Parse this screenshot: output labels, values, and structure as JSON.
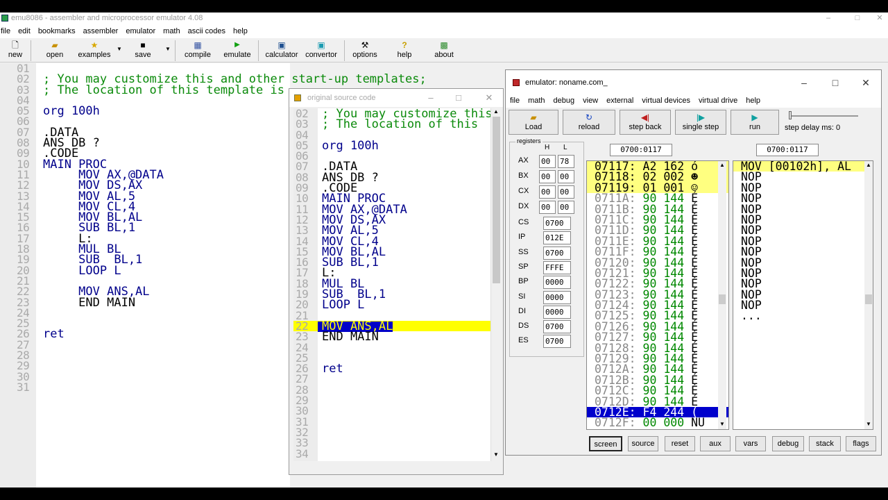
{
  "main_window": {
    "title": "emu8086 - assembler and microprocessor emulator 4.08",
    "menu": [
      "file",
      "edit",
      "bookmarks",
      "assembler",
      "emulator",
      "math",
      "ascii codes",
      "help"
    ],
    "toolbar": {
      "new": "new",
      "open": "open",
      "examples": "examples",
      "save": "save",
      "compile": "compile",
      "emulate": "emulate",
      "calculator": "calculator",
      "convertor": "convertor",
      "options": "options",
      "help": "help",
      "about": "about"
    }
  },
  "editor": {
    "lines": [
      {
        "n": "01",
        "t": "",
        "c": "c-black"
      },
      {
        "n": "02",
        "t": "; You may customize this and other start-up templates;",
        "c": "c-green"
      },
      {
        "n": "03",
        "t": "; The location of this template is",
        "c": "c-green"
      },
      {
        "n": "04",
        "t": "",
        "c": "c-black"
      },
      {
        "n": "05",
        "t": "org 100h",
        "c": "c-blue"
      },
      {
        "n": "06",
        "t": "",
        "c": "c-black"
      },
      {
        "n": "07",
        "t": ".DATA",
        "c": "c-black"
      },
      {
        "n": "08",
        "t": "ANS DB ?",
        "c": "c-black"
      },
      {
        "n": "09",
        "t": ".CODE",
        "c": "c-black"
      },
      {
        "n": "10",
        "t": "MAIN PROC",
        "c": "c-blue"
      },
      {
        "n": "11",
        "t": "     MOV AX,@DATA",
        "c": "c-blue"
      },
      {
        "n": "12",
        "t": "     MOV DS,AX",
        "c": "c-blue"
      },
      {
        "n": "13",
        "t": "     MOV AL,5",
        "c": "c-blue"
      },
      {
        "n": "14",
        "t": "     MOV CL,4",
        "c": "c-blue"
      },
      {
        "n": "15",
        "t": "     MOV BL,AL",
        "c": "c-blue"
      },
      {
        "n": "16",
        "t": "     SUB BL,1",
        "c": "c-blue"
      },
      {
        "n": "17",
        "t": "     L:",
        "c": "c-black"
      },
      {
        "n": "18",
        "t": "     MUL BL",
        "c": "c-blue"
      },
      {
        "n": "19",
        "t": "     SUB  BL,1",
        "c": "c-blue"
      },
      {
        "n": "20",
        "t": "     LOOP L",
        "c": "c-blue"
      },
      {
        "n": "21",
        "t": "",
        "c": "c-black"
      },
      {
        "n": "22",
        "t": "     MOV ANS,AL",
        "c": "c-blue"
      },
      {
        "n": "23",
        "t": "     END MAIN",
        "c": "c-black"
      },
      {
        "n": "24",
        "t": "",
        "c": "c-black"
      },
      {
        "n": "25",
        "t": "",
        "c": "c-black"
      },
      {
        "n": "26",
        "t": "ret",
        "c": "c-blue"
      },
      {
        "n": "27",
        "t": "",
        "c": "c-black"
      },
      {
        "n": "28",
        "t": "",
        "c": "c-black"
      },
      {
        "n": "29",
        "t": "",
        "c": "c-black"
      },
      {
        "n": "30",
        "t": "",
        "c": "c-black"
      },
      {
        "n": "31",
        "t": "",
        "c": "c-black"
      }
    ]
  },
  "source_window": {
    "title": "original source code",
    "highlight_line": "22",
    "lines": [
      {
        "n": "02",
        "t": "; You may customize this",
        "c": "c-green"
      },
      {
        "n": "03",
        "t": "; The location of this",
        "c": "c-green"
      },
      {
        "n": "04",
        "t": "",
        "c": "c-black"
      },
      {
        "n": "05",
        "t": "org 100h",
        "c": "c-blue"
      },
      {
        "n": "06",
        "t": "",
        "c": "c-black"
      },
      {
        "n": "07",
        "t": ".DATA",
        "c": "c-black"
      },
      {
        "n": "08",
        "t": "ANS DB ?",
        "c": "c-black"
      },
      {
        "n": "09",
        "t": ".CODE",
        "c": "c-black"
      },
      {
        "n": "10",
        "t": "MAIN PROC",
        "c": "c-blue"
      },
      {
        "n": "11",
        "t": "MOV AX,@DATA",
        "c": "c-blue"
      },
      {
        "n": "12",
        "t": "MOV DS,AX",
        "c": "c-blue"
      },
      {
        "n": "13",
        "t": "MOV AL,5",
        "c": "c-blue"
      },
      {
        "n": "14",
        "t": "MOV CL,4",
        "c": "c-blue"
      },
      {
        "n": "15",
        "t": "MOV BL,AL",
        "c": "c-blue"
      },
      {
        "n": "16",
        "t": "SUB BL,1",
        "c": "c-blue"
      },
      {
        "n": "17",
        "t": "L:",
        "c": "c-black"
      },
      {
        "n": "18",
        "t": "MUL BL",
        "c": "c-blue"
      },
      {
        "n": "19",
        "t": "SUB  BL,1",
        "c": "c-blue"
      },
      {
        "n": "20",
        "t": "LOOP L",
        "c": "c-blue"
      },
      {
        "n": "21",
        "t": "",
        "c": "c-black"
      },
      {
        "n": "22",
        "t": "MOV ANS,AL",
        "c": "c-blue"
      },
      {
        "n": "23",
        "t": "END MAIN",
        "c": "c-black"
      },
      {
        "n": "24",
        "t": "",
        "c": "c-black"
      },
      {
        "n": "25",
        "t": "",
        "c": "c-black"
      },
      {
        "n": "26",
        "t": "ret",
        "c": "c-blue"
      },
      {
        "n": "27",
        "t": "",
        "c": "c-black"
      },
      {
        "n": "28",
        "t": "",
        "c": "c-black"
      },
      {
        "n": "29",
        "t": "",
        "c": "c-black"
      },
      {
        "n": "30",
        "t": "",
        "c": "c-black"
      },
      {
        "n": "31",
        "t": "",
        "c": "c-black"
      },
      {
        "n": "32",
        "t": "",
        "c": "c-black"
      },
      {
        "n": "33",
        "t": "",
        "c": "c-black"
      },
      {
        "n": "34",
        "t": "",
        "c": "c-black"
      }
    ]
  },
  "emulator": {
    "title": "emulator: noname.com_",
    "menu": [
      "file",
      "math",
      "debug",
      "view",
      "external",
      "virtual devices",
      "virtual drive",
      "help"
    ],
    "buttons": {
      "load": "Load",
      "reload": "reload",
      "step_back": "step back",
      "single_step": "single step",
      "run": "run",
      "step_delay": "step delay ms: 0"
    },
    "registers_caption": "registers",
    "h_label": "H",
    "l_label": "L",
    "regs_hl": [
      {
        "name": "AX",
        "h": "00",
        "l": "78"
      },
      {
        "name": "BX",
        "h": "00",
        "l": "00"
      },
      {
        "name": "CX",
        "h": "00",
        "l": "00"
      },
      {
        "name": "DX",
        "h": "00",
        "l": "00"
      }
    ],
    "regs16": [
      {
        "name": "CS",
        "v": "0700"
      },
      {
        "name": "IP",
        "v": "012E"
      },
      {
        "name": "SS",
        "v": "0700"
      },
      {
        "name": "SP",
        "v": "FFFE"
      },
      {
        "name": "BP",
        "v": "0000"
      },
      {
        "name": "SI",
        "v": "0000"
      },
      {
        "name": "DI",
        "v": "0000"
      },
      {
        "name": "DS",
        "v": "0700"
      },
      {
        "name": "ES",
        "v": "0700"
      }
    ],
    "mem_address": "0700:0117",
    "dis_address": "0700:0117",
    "memory": [
      {
        "a": "07117:",
        "h": "A2",
        "d": "162",
        "c": "ó",
        "s": "hy"
      },
      {
        "a": "07118:",
        "h": "02",
        "d": "002",
        "c": "☻",
        "s": "hy"
      },
      {
        "a": "07119:",
        "h": "01",
        "d": "001",
        "c": "☺",
        "s": "hy"
      },
      {
        "a": "0711A:",
        "h": "90",
        "d": "144",
        "c": "É",
        "s": ""
      },
      {
        "a": "0711B:",
        "h": "90",
        "d": "144",
        "c": "É",
        "s": ""
      },
      {
        "a": "0711C:",
        "h": "90",
        "d": "144",
        "c": "É",
        "s": ""
      },
      {
        "a": "0711D:",
        "h": "90",
        "d": "144",
        "c": "É",
        "s": ""
      },
      {
        "a": "0711E:",
        "h": "90",
        "d": "144",
        "c": "É",
        "s": ""
      },
      {
        "a": "0711F:",
        "h": "90",
        "d": "144",
        "c": "É",
        "s": ""
      },
      {
        "a": "07120:",
        "h": "90",
        "d": "144",
        "c": "É",
        "s": ""
      },
      {
        "a": "07121:",
        "h": "90",
        "d": "144",
        "c": "É",
        "s": ""
      },
      {
        "a": "07122:",
        "h": "90",
        "d": "144",
        "c": "É",
        "s": ""
      },
      {
        "a": "07123:",
        "h": "90",
        "d": "144",
        "c": "É",
        "s": ""
      },
      {
        "a": "07124:",
        "h": "90",
        "d": "144",
        "c": "É",
        "s": ""
      },
      {
        "a": "07125:",
        "h": "90",
        "d": "144",
        "c": "É",
        "s": ""
      },
      {
        "a": "07126:",
        "h": "90",
        "d": "144",
        "c": "É",
        "s": ""
      },
      {
        "a": "07127:",
        "h": "90",
        "d": "144",
        "c": "É",
        "s": ""
      },
      {
        "a": "07128:",
        "h": "90",
        "d": "144",
        "c": "É",
        "s": ""
      },
      {
        "a": "07129:",
        "h": "90",
        "d": "144",
        "c": "É",
        "s": ""
      },
      {
        "a": "0712A:",
        "h": "90",
        "d": "144",
        "c": "É",
        "s": ""
      },
      {
        "a": "0712B:",
        "h": "90",
        "d": "144",
        "c": "É",
        "s": ""
      },
      {
        "a": "0712C:",
        "h": "90",
        "d": "144",
        "c": "É",
        "s": ""
      },
      {
        "a": "0712D:",
        "h": "90",
        "d": "144",
        "c": "É",
        "s": ""
      },
      {
        "a": "0712E:",
        "h": "F4",
        "d": "244",
        "c": "(",
        "s": "sel"
      },
      {
        "a": "0712F:",
        "h": "00",
        "d": "000",
        "c": "NU",
        "s": ""
      }
    ],
    "disassembly": [
      {
        "t": "MOV [00102h], AL",
        "s": "hy"
      },
      {
        "t": "NOP",
        "s": ""
      },
      {
        "t": "NOP",
        "s": ""
      },
      {
        "t": "NOP",
        "s": ""
      },
      {
        "t": "NOP",
        "s": ""
      },
      {
        "t": "NOP",
        "s": ""
      },
      {
        "t": "NOP",
        "s": ""
      },
      {
        "t": "NOP",
        "s": ""
      },
      {
        "t": "NOP",
        "s": ""
      },
      {
        "t": "NOP",
        "s": ""
      },
      {
        "t": "NOP",
        "s": ""
      },
      {
        "t": "NOP",
        "s": ""
      },
      {
        "t": "NOP",
        "s": ""
      },
      {
        "t": "NOP",
        "s": ""
      },
      {
        "t": "...",
        "s": ""
      }
    ],
    "bottom_buttons": [
      "screen",
      "source",
      "reset",
      "aux",
      "vars",
      "debug",
      "stack",
      "flags"
    ]
  }
}
